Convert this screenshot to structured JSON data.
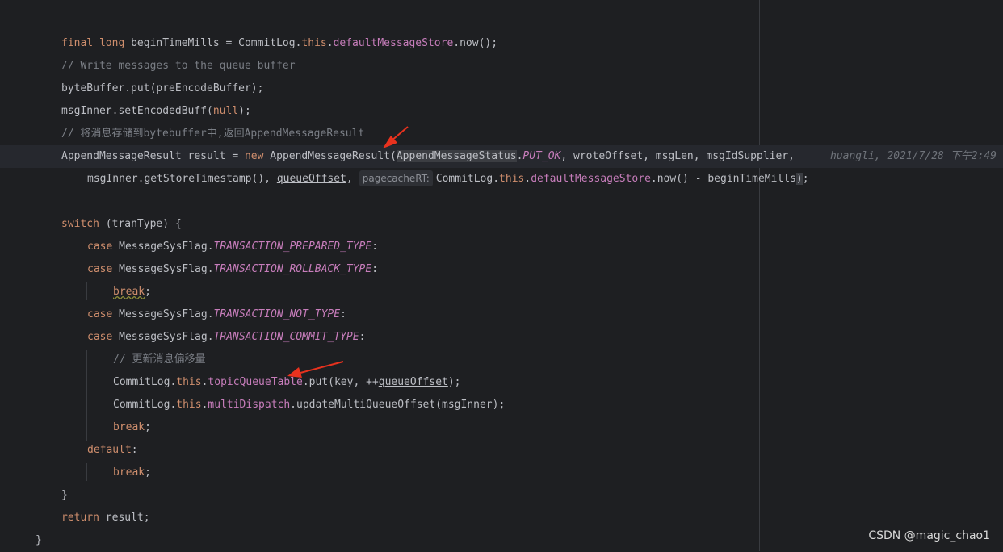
{
  "editor": {
    "lines": [
      {
        "a": "final long ",
        "b": "beginTimeMills = CommitLog.",
        "c": "this",
        "d": ".",
        "e": "defaultMessageStore",
        "f": ".now();"
      },
      {
        "comment": "// Write messages to the queue buffer"
      },
      {
        "text": "byteBuffer.put(preEncodeBuffer);"
      },
      {
        "a": "msgInner.setEncodedBuff(",
        "b": "null",
        "c": ");"
      },
      {
        "comment": "// 将消息存储到bytebuffer中,返回AppendMessageResult"
      },
      {
        "a": "AppendMessageResult result = ",
        "b": "new",
        "c": " AppendMessageResult(",
        "d": "AppendMessageStatus",
        "e": ".",
        "f": "PUT_OK",
        "g": ", wroteOffset, msgLen, msgIdSupplier,"
      },
      {
        "a": "msgInner.getStoreTimestamp(), ",
        "b": "queueOffset",
        "c": ",",
        "hint": "pagecacheRT:",
        "d": "CommitLog.",
        "e": "this",
        "f": ".",
        "g": "defaultMessageStore",
        "h": ".now() - beginTimeMills",
        "i": ")",
        "j": ";"
      },
      {
        "a": "switch",
        "b": " (tranType) {"
      },
      {
        "a": "case",
        "b": " MessageSysFlag.",
        "c": "TRANSACTION_PREPARED_TYPE",
        "d": ":"
      },
      {
        "a": "case",
        "b": " MessageSysFlag.",
        "c": "TRANSACTION_ROLLBACK_TYPE",
        "d": ":"
      },
      {
        "a": "break",
        "b": ";"
      },
      {
        "a": "case",
        "b": " MessageSysFlag.",
        "c": "TRANSACTION_NOT_TYPE",
        "d": ":"
      },
      {
        "a": "case",
        "b": " MessageSysFlag.",
        "c": "TRANSACTION_COMMIT_TYPE",
        "d": ":"
      },
      {
        "comment": "// 更新消息偏移量"
      },
      {
        "a": "CommitLog.",
        "b": "this",
        "c": ".",
        "d": "topicQueueTable",
        "e": ".put(key, ++",
        "f": "queueOffset",
        "g": ");"
      },
      {
        "a": "CommitLog.",
        "b": "this",
        "c": ".",
        "d": "multiDispatch",
        "e": ".updateMultiQueueOffset(msgInner);"
      },
      {
        "a": "break",
        "b": ";"
      },
      {
        "a": "default",
        "b": ":"
      },
      {
        "a": "break",
        "b": ";"
      },
      {
        "text": "}"
      },
      {
        "a": "return",
        "b": " result;"
      },
      {
        "text": "}"
      }
    ],
    "blame": "huangli, 2021/7/28 下午2:49",
    "watermark": "CSDN @magic_chao1",
    "annotation_color": "#e8321e"
  }
}
